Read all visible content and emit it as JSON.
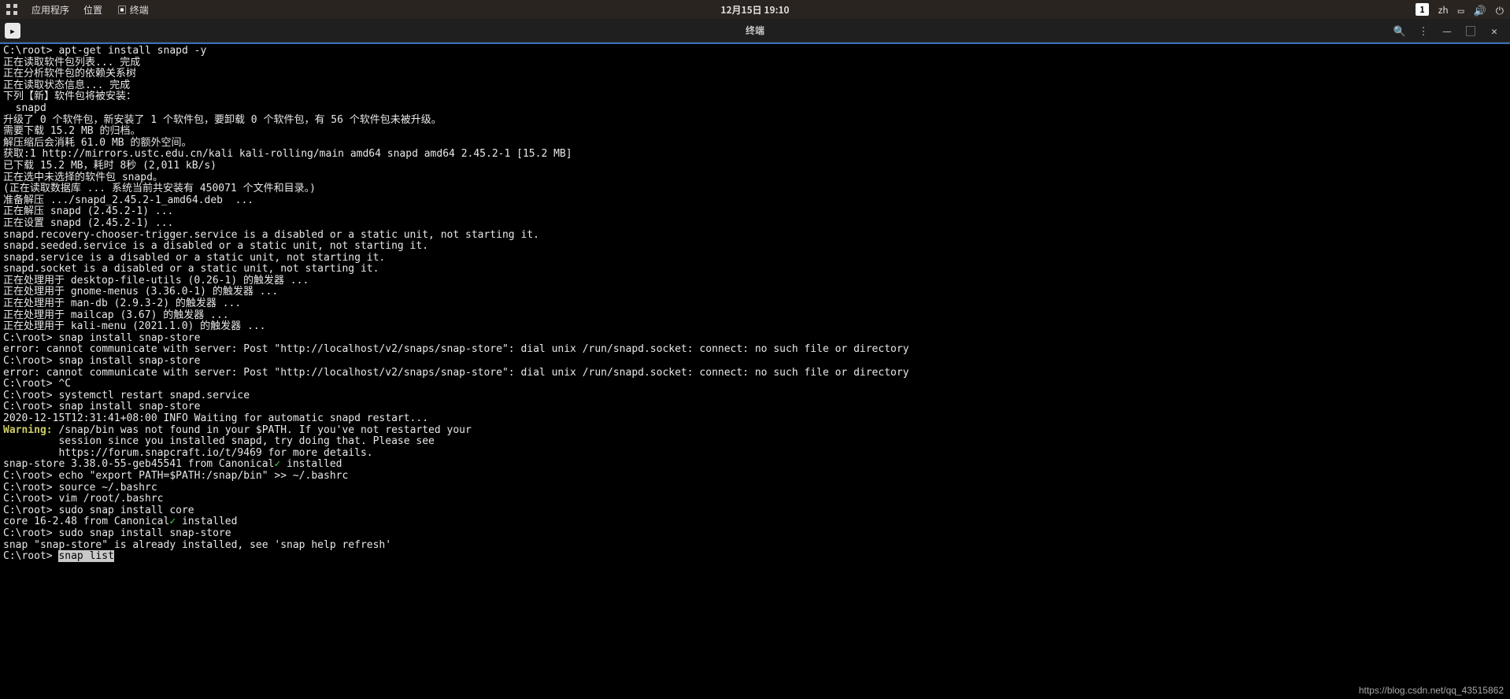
{
  "topbar": {
    "apps": "应用程序",
    "places": "位置",
    "terminal_label": "终端",
    "datetime": "12月15日 19:10",
    "workspace": "1",
    "input_method": "zh"
  },
  "window": {
    "title": "终端"
  },
  "prompt": "C:\\root> ",
  "terminal": {
    "lines": [
      {
        "t": "cmd",
        "text": "apt-get install snapd -y"
      },
      {
        "t": "out",
        "text": "正在读取软件包列表... 完成"
      },
      {
        "t": "out",
        "text": "正在分析软件包的依赖关系树"
      },
      {
        "t": "out",
        "text": "正在读取状态信息... 完成"
      },
      {
        "t": "out",
        "text": "下列【新】软件包将被安装："
      },
      {
        "t": "out",
        "text": "  snapd"
      },
      {
        "t": "out",
        "text": "升级了 0 个软件包，新安装了 1 个软件包，要卸载 0 个软件包，有 56 个软件包未被升级。"
      },
      {
        "t": "out",
        "text": "需要下载 15.2 MB 的归档。"
      },
      {
        "t": "out",
        "text": "解压缩后会消耗 61.0 MB 的额外空间。"
      },
      {
        "t": "out",
        "text": "获取:1 http://mirrors.ustc.edu.cn/kali kali-rolling/main amd64 snapd amd64 2.45.2-1 [15.2 MB]"
      },
      {
        "t": "out",
        "text": "已下载 15.2 MB，耗时 8秒 (2,011 kB/s)"
      },
      {
        "t": "out",
        "text": "正在选中未选择的软件包 snapd。"
      },
      {
        "t": "out",
        "text": "(正在读取数据库 ... 系统当前共安装有 450071 个文件和目录。)"
      },
      {
        "t": "out",
        "text": "准备解压 .../snapd_2.45.2-1_amd64.deb  ..."
      },
      {
        "t": "out",
        "text": "正在解压 snapd (2.45.2-1) ..."
      },
      {
        "t": "out",
        "text": "正在设置 snapd (2.45.2-1) ..."
      },
      {
        "t": "out",
        "text": "snapd.recovery-chooser-trigger.service is a disabled or a static unit, not starting it."
      },
      {
        "t": "out",
        "text": "snapd.seeded.service is a disabled or a static unit, not starting it."
      },
      {
        "t": "out",
        "text": "snapd.service is a disabled or a static unit, not starting it."
      },
      {
        "t": "out",
        "text": "snapd.socket is a disabled or a static unit, not starting it."
      },
      {
        "t": "out",
        "text": "正在处理用于 desktop-file-utils (0.26-1) 的触发器 ..."
      },
      {
        "t": "out",
        "text": "正在处理用于 gnome-menus (3.36.0-1) 的触发器 ..."
      },
      {
        "t": "out",
        "text": "正在处理用于 man-db (2.9.3-2) 的触发器 ..."
      },
      {
        "t": "out",
        "text": "正在处理用于 mailcap (3.67) 的触发器 ..."
      },
      {
        "t": "out",
        "text": "正在处理用于 kali-menu (2021.1.0) 的触发器 ..."
      },
      {
        "t": "cmd",
        "text": "snap install snap-store"
      },
      {
        "t": "out",
        "text": "error: cannot communicate with server: Post \"http://localhost/v2/snaps/snap-store\": dial unix /run/snapd.socket: connect: no such file or directory"
      },
      {
        "t": "cmd",
        "text": "snap install snap-store"
      },
      {
        "t": "out",
        "text": "error: cannot communicate with server: Post \"http://localhost/v2/snaps/snap-store\": dial unix /run/snapd.socket: connect: no such file or directory"
      },
      {
        "t": "cmd",
        "text": "^C"
      },
      {
        "t": "cmd",
        "text": "systemctl restart snapd.service"
      },
      {
        "t": "cmd",
        "text": "snap install snap-store"
      },
      {
        "t": "out",
        "text": "2020-12-15T12:31:41+08:00 INFO Waiting for automatic snapd restart..."
      },
      {
        "t": "warn",
        "prefix": "Warning:",
        "text": " /snap/bin was not found in your $PATH. If you've not restarted your"
      },
      {
        "t": "out",
        "text": "         session since you installed snapd, try doing that. Please see"
      },
      {
        "t": "out",
        "text": "         https://forum.snapcraft.io/t/9469 for more details."
      },
      {
        "t": "out",
        "text": ""
      },
      {
        "t": "install",
        "pre": "snap-store 3.38.0-55-geb45541 from Canonical",
        "check": "✓",
        "post": " installed"
      },
      {
        "t": "cmd",
        "text": "echo \"export PATH=$PATH:/snap/bin\" >> ~/.bashrc"
      },
      {
        "t": "cmd",
        "text": "source ~/.bashrc"
      },
      {
        "t": "cmd",
        "text": "vim /root/.bashrc"
      },
      {
        "t": "cmd",
        "text": "sudo snap install core"
      },
      {
        "t": "install",
        "pre": "core 16-2.48 from Canonical",
        "check": "✓",
        "post": " installed"
      },
      {
        "t": "cmd",
        "text": "sudo snap install snap-store"
      },
      {
        "t": "out",
        "text": "snap \"snap-store\" is already installed, see 'snap help refresh'"
      },
      {
        "t": "cmd-sel",
        "text": "snap list"
      }
    ]
  },
  "watermark": "https://blog.csdn.net/qq_43515862"
}
